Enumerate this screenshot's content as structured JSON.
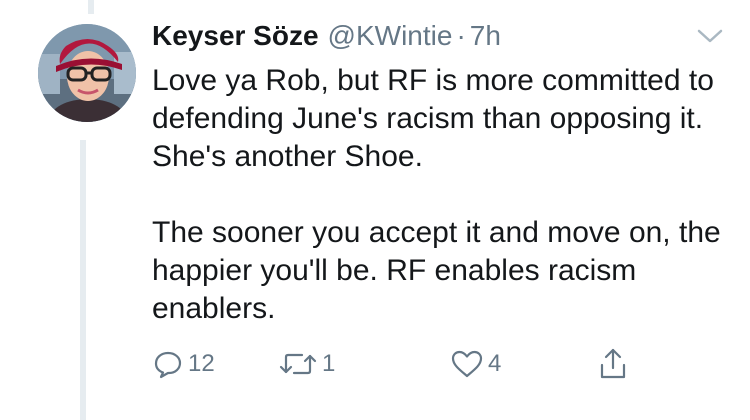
{
  "tweet": {
    "display_name": "Keyser Söze",
    "handle": "@KWintie",
    "separator": "·",
    "time": "7h",
    "paragraphs": [
      "Love ya Rob, but RF is more committed to defending June's racism than opposing it. She's another Shoe.",
      "The sooner you accept it and move on, the happier you'll be. RF enables racism enablers."
    ]
  },
  "actions": {
    "reply_count": "12",
    "retweet_count": "1",
    "like_count": "4"
  },
  "colors": {
    "text": "#14171a",
    "secondary": "#657786",
    "thread_line": "#e6ecf0",
    "icon": "#657786"
  },
  "icons": [
    "chevron-down-icon",
    "reply-icon",
    "retweet-icon",
    "heart-icon",
    "share-icon"
  ]
}
